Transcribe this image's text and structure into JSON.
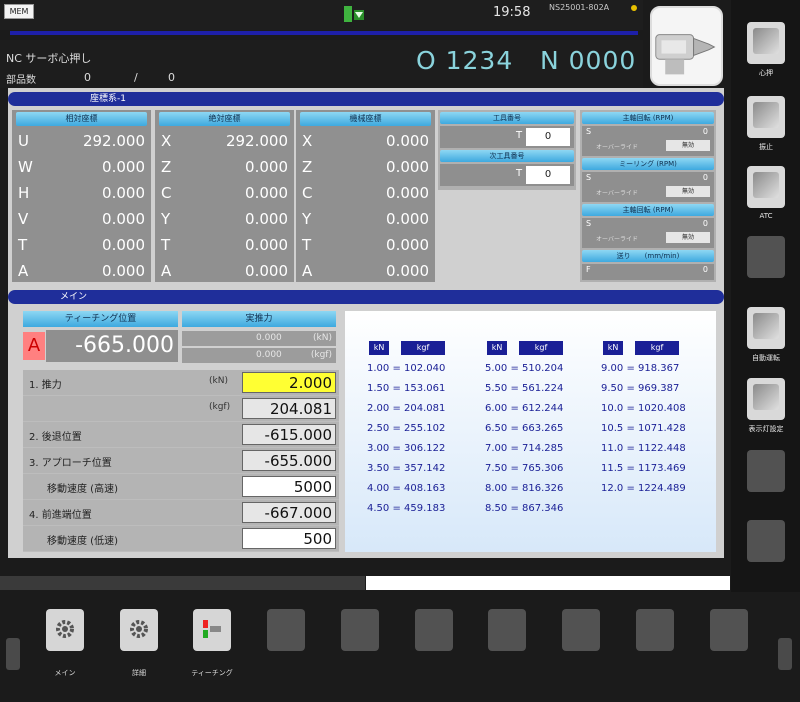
{
  "top": {
    "mode": "MEM",
    "clock": "19:58",
    "serial": "NS25001-802A"
  },
  "header": {
    "nc_mode": "NC サーボ心押し",
    "parts_label": "部品数",
    "parts_count": "0",
    "parts_separator": "/",
    "parts_total": "0",
    "program": "O 1234",
    "sequence": "N 0000"
  },
  "side_buttons": [
    {
      "label": "心押",
      "icon": "tailstock-icon"
    },
    {
      "label": "振止",
      "icon": "steady-rest-icon"
    },
    {
      "label": "ATC",
      "icon": "atc-icon"
    },
    {
      "label": "",
      "icon": ""
    },
    {
      "label": "自動運転",
      "icon": "auto-operation-icon"
    },
    {
      "label": "表示灯設定",
      "icon": "indicator-light-icon"
    },
    {
      "label": "",
      "icon": ""
    },
    {
      "label": "",
      "icon": ""
    }
  ],
  "coords": {
    "section_title": "座標系-1",
    "columns": [
      {
        "title": "相対座標",
        "rows": [
          {
            "axis": "U",
            "value": "292.000"
          },
          {
            "axis": "W",
            "value": "0.000"
          },
          {
            "axis": "H",
            "value": "0.000"
          },
          {
            "axis": "V",
            "value": "0.000"
          },
          {
            "axis": "T",
            "value": "0.000"
          },
          {
            "axis": "A",
            "value": "0.000"
          }
        ]
      },
      {
        "title": "絶対座標",
        "rows": [
          {
            "axis": "X",
            "value": "292.000"
          },
          {
            "axis": "Z",
            "value": "0.000"
          },
          {
            "axis": "C",
            "value": "0.000"
          },
          {
            "axis": "Y",
            "value": "0.000"
          },
          {
            "axis": "T",
            "value": "0.000"
          },
          {
            "axis": "A",
            "value": "0.000"
          }
        ]
      },
      {
        "title": "機械座標",
        "rows": [
          {
            "axis": "X",
            "value": "0.000"
          },
          {
            "axis": "Z",
            "value": "0.000"
          },
          {
            "axis": "C",
            "value": "0.000"
          },
          {
            "axis": "Y",
            "value": "0.000"
          },
          {
            "axis": "T",
            "value": "0.000"
          },
          {
            "axis": "A",
            "value": "0.000"
          }
        ]
      }
    ]
  },
  "tool": {
    "current_title": "工具番号",
    "current_label": "T",
    "current_value": "0",
    "next_title": "次工具番号",
    "next_label": "T",
    "next_value": "0"
  },
  "spindle": {
    "sections": [
      {
        "title": "主軸回転 (RPM)",
        "label": "S",
        "value": "0",
        "override_label": "オーバーライド",
        "override_value": "無効"
      },
      {
        "title": "ミーリング (RPM)",
        "label": "S",
        "value": "0",
        "override_label": "オーバーライド",
        "override_value": "無効"
      },
      {
        "title": "主軸回転 (RPM)",
        "label": "S",
        "value": "0",
        "override_label": "オーバーライド",
        "override_value": "無効"
      },
      {
        "title": "送り",
        "unit": "(mm/min)",
        "label": "F",
        "value": "0"
      }
    ]
  },
  "main": {
    "section_title": "メイン",
    "teach_title": "ティーチング位置",
    "teach_axis": "A",
    "teach_value": "-665.000",
    "force_title": "実推力",
    "force_kn": "0.000",
    "force_kn_unit": "(kN)",
    "force_kgf": "0.000",
    "force_kgf_unit": "(kgf)",
    "settings": [
      {
        "label": "1. 推力",
        "unit": "(kN)",
        "value": "2.000",
        "style": "yellow"
      },
      {
        "label": "",
        "unit": "(kgf)",
        "value": "204.081",
        "style": "gray"
      },
      {
        "label": "2. 後退位置",
        "unit": "",
        "value": "-615.000",
        "style": "gray"
      },
      {
        "label": "3. アプローチ位置",
        "unit": "",
        "value": "-655.000",
        "style": "gray"
      },
      {
        "label": "移動速度 (高速)",
        "unit": "",
        "value": "5000",
        "style": "white",
        "indent": true
      },
      {
        "label": "4. 前進端位置",
        "unit": "",
        "value": "-667.000",
        "style": "gray"
      },
      {
        "label": "移動速度 (低速)",
        "unit": "",
        "value": "500",
        "style": "white",
        "indent": true
      }
    ]
  },
  "conversion": {
    "head_kn": "kN",
    "head_kgf": "kgf",
    "columns": [
      [
        "1.00 = 102.040",
        "1.50 = 153.061",
        "2.00 = 204.081",
        "2.50 = 255.102",
        "3.00 = 306.122",
        "3.50 = 357.142",
        "4.00 = 408.163",
        "4.50 = 459.183"
      ],
      [
        "5.00 = 510.204",
        "5.50 = 561.224",
        "6.00 = 612.244",
        "6.50 = 663.265",
        "7.00 = 714.285",
        "7.50 = 765.306",
        "8.00 = 816.326",
        "8.50 = 867.346"
      ],
      [
        "9.00 = 918.367",
        "9.50 = 969.387",
        "10.0 = 1020.408",
        "10.5 = 1071.428",
        "11.0 = 1122.448",
        "11.5 = 1173.469",
        "12.0 = 1224.489"
      ]
    ]
  },
  "softkeys": [
    {
      "label": "メイン",
      "icon": "gear-icon",
      "lit": true
    },
    {
      "label": "詳細",
      "icon": "gears-icon",
      "lit": true
    },
    {
      "label": "ティーチング",
      "icon": "teaching-icon",
      "lit": true
    },
    {
      "label": "",
      "lit": false
    },
    {
      "label": "",
      "lit": false
    },
    {
      "label": "",
      "lit": false
    },
    {
      "label": "",
      "lit": false
    },
    {
      "label": "",
      "lit": false
    },
    {
      "label": "",
      "lit": false
    },
    {
      "label": "",
      "lit": false
    }
  ]
}
